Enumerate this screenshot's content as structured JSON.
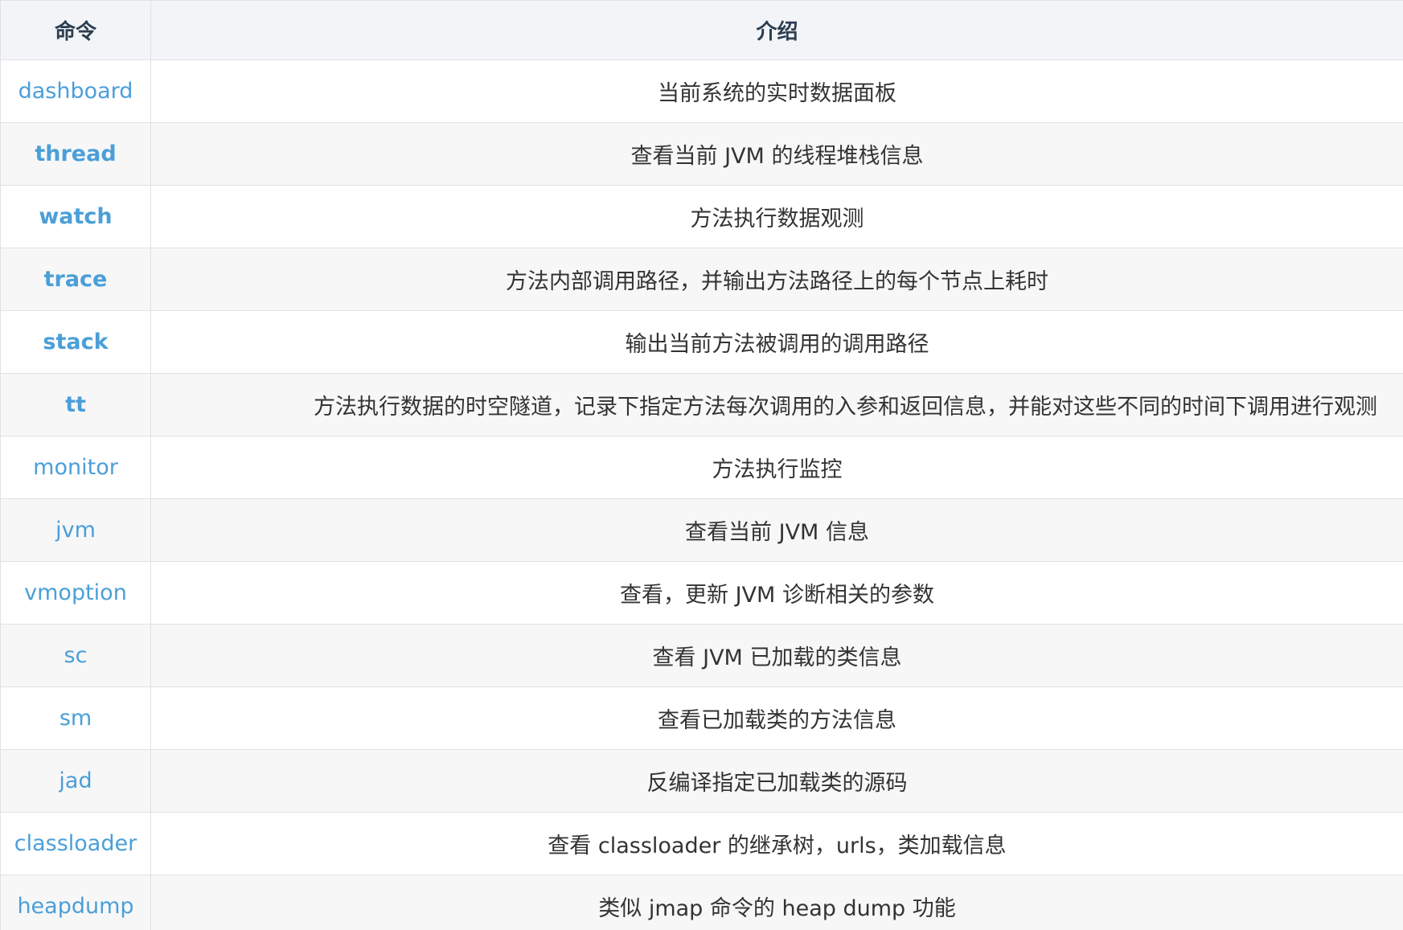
{
  "header": {
    "command": "命令",
    "intro": "介绍"
  },
  "rows": [
    {
      "cmd": "dashboard",
      "bold": false,
      "desc": "当前系统的实时数据面板"
    },
    {
      "cmd": "thread",
      "bold": true,
      "desc": "查看当前 JVM 的线程堆栈信息"
    },
    {
      "cmd": "watch",
      "bold": true,
      "desc": "方法执行数据观测"
    },
    {
      "cmd": "trace",
      "bold": true,
      "desc": "方法内部调用路径，并输出方法路径上的每个节点上耗时"
    },
    {
      "cmd": "stack",
      "bold": true,
      "desc": "输出当前方法被调用的调用路径"
    },
    {
      "cmd": "tt",
      "bold": true,
      "desc": "方法执行数据的时空隧道，记录下指定方法每次调用的入参和返回信息，并能对这些不同的时间下调用进行观测"
    },
    {
      "cmd": "monitor",
      "bold": false,
      "desc": "方法执行监控"
    },
    {
      "cmd": "jvm",
      "bold": false,
      "desc": "查看当前 JVM 信息"
    },
    {
      "cmd": "vmoption",
      "bold": false,
      "desc": "查看，更新 JVM 诊断相关的参数"
    },
    {
      "cmd": "sc",
      "bold": false,
      "desc": "查看 JVM 已加载的类信息"
    },
    {
      "cmd": "sm",
      "bold": false,
      "desc": "查看已加载类的方法信息"
    },
    {
      "cmd": "jad",
      "bold": false,
      "desc": "反编译指定已加载类的源码"
    },
    {
      "cmd": "classloader",
      "bold": false,
      "desc": "查看 classloader 的继承树，urls，类加载信息"
    },
    {
      "cmd": "heapdump",
      "bold": false,
      "desc": "类似 jmap 命令的 heap dump 功能"
    }
  ],
  "colors": {
    "link": "#4a9fd8",
    "header_bg": "#f2f4f7",
    "stripe_bg": "#f7f7f8",
    "border": "#dfe2e5"
  }
}
